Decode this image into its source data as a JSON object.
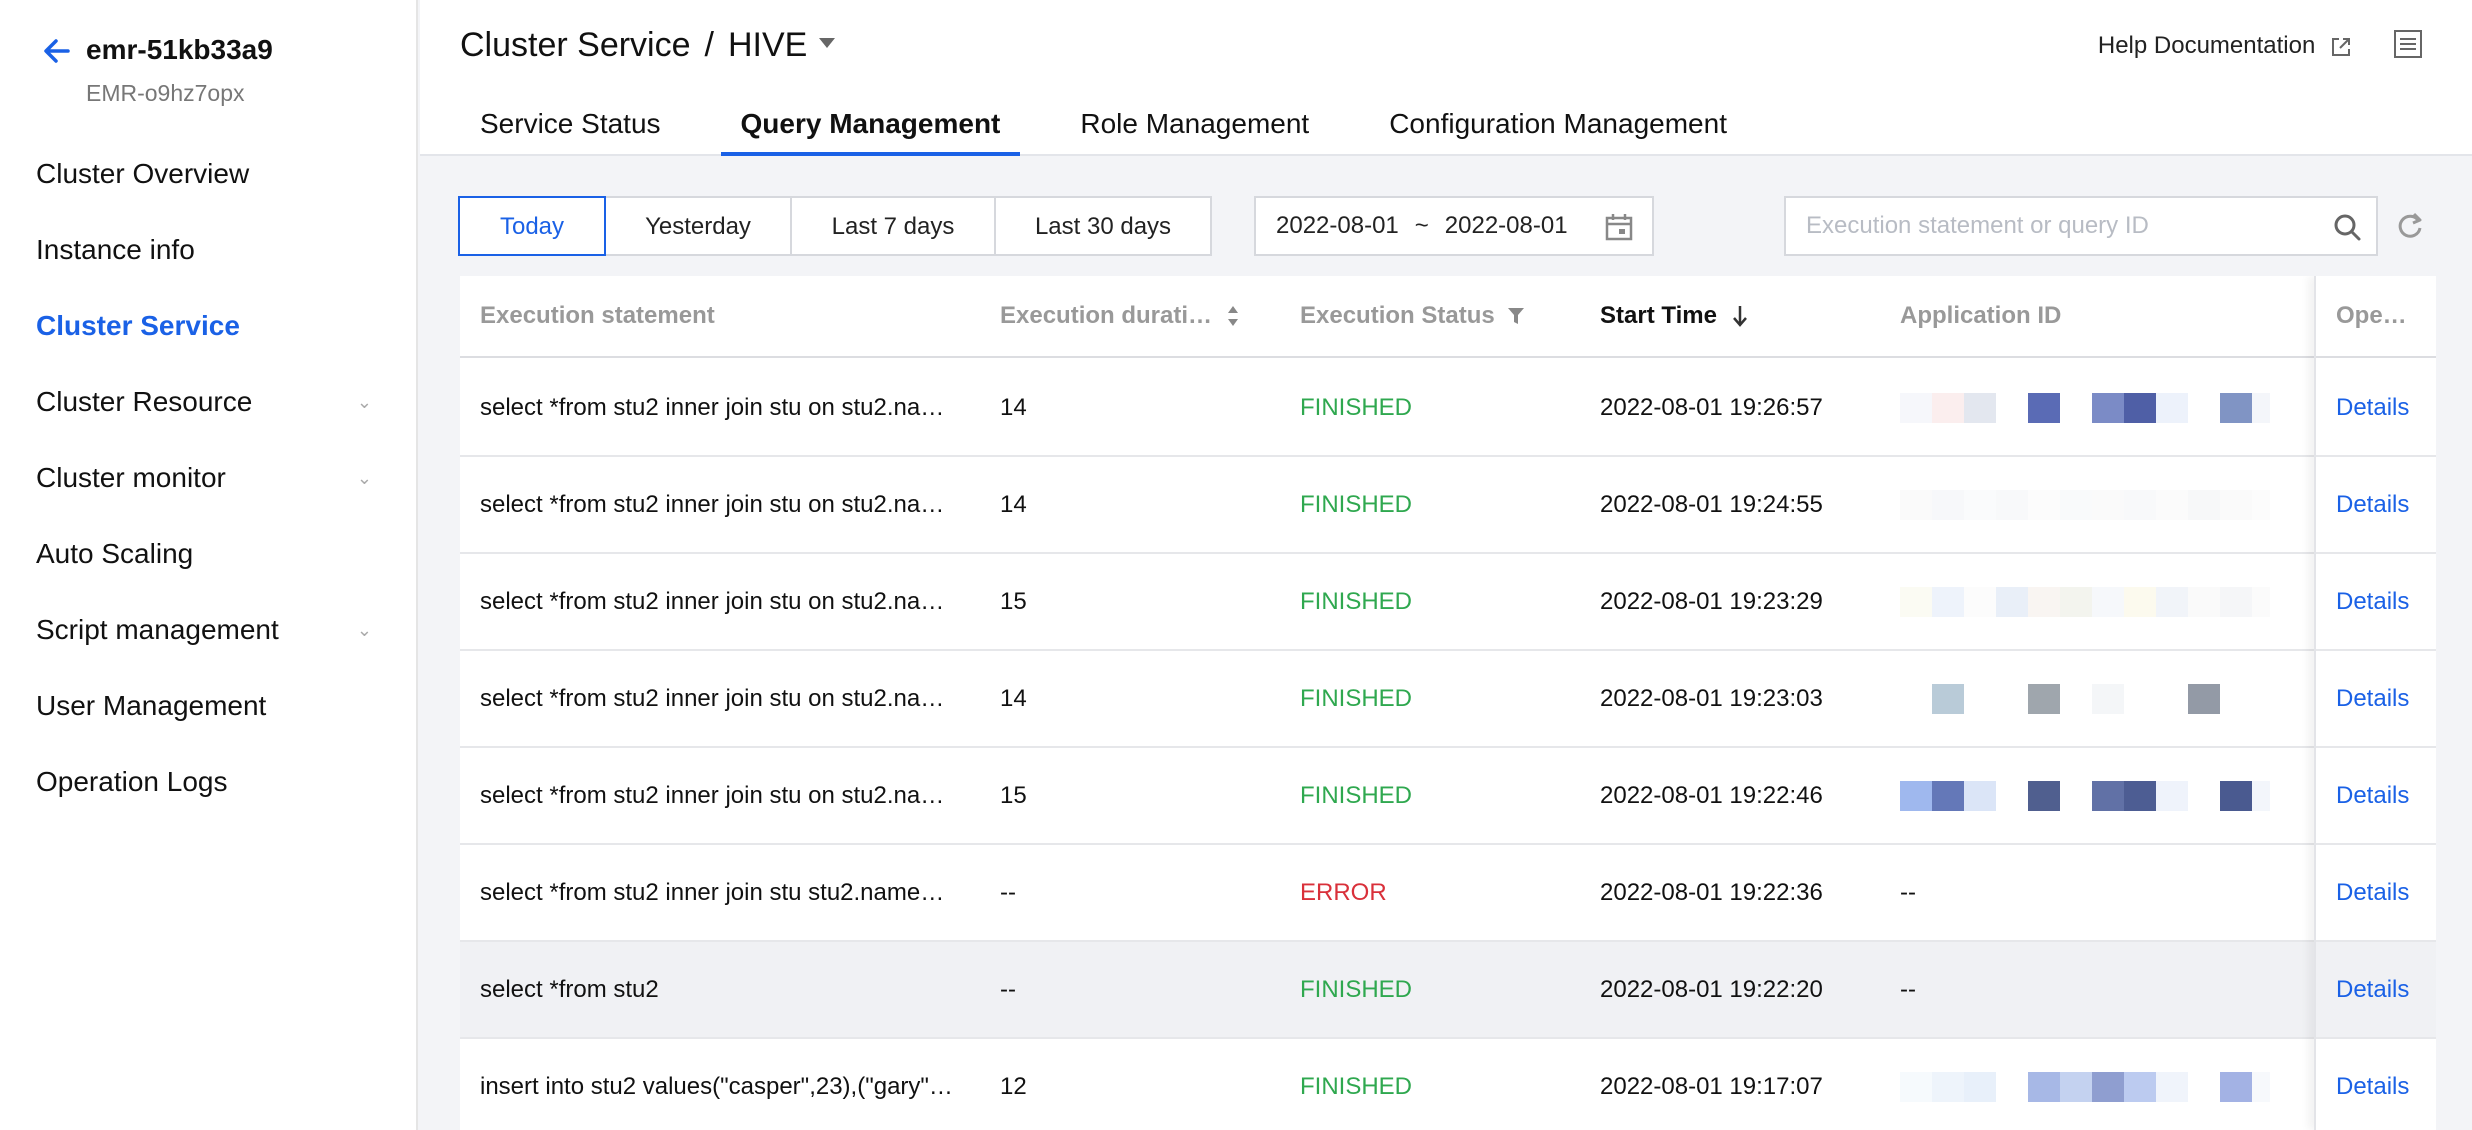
{
  "sidebar": {
    "cluster_name": "emr-51kb33a9",
    "cluster_id": "EMR-o9hz7opx",
    "items": [
      {
        "label": "Cluster Overview",
        "active": false,
        "expandable": false
      },
      {
        "label": "Instance info",
        "active": false,
        "expandable": false
      },
      {
        "label": "Cluster Service",
        "active": true,
        "expandable": false
      },
      {
        "label": "Cluster Resource",
        "active": false,
        "expandable": true
      },
      {
        "label": "Cluster monitor",
        "active": false,
        "expandable": true
      },
      {
        "label": "Auto Scaling",
        "active": false,
        "expandable": false
      },
      {
        "label": "Script management",
        "active": false,
        "expandable": true
      },
      {
        "label": "User Management",
        "active": false,
        "expandable": false
      },
      {
        "label": "Operation Logs",
        "active": false,
        "expandable": false
      }
    ]
  },
  "header": {
    "breadcrumb_parent": "Cluster Service",
    "breadcrumb_sep": "/",
    "breadcrumb_current": "HIVE",
    "help_label": "Help Documentation",
    "tabs": [
      {
        "label": "Service Status",
        "active": false
      },
      {
        "label": "Query Management",
        "active": true
      },
      {
        "label": "Role Management",
        "active": false
      },
      {
        "label": "Configuration Management",
        "active": false
      }
    ]
  },
  "filters": {
    "ranges": [
      {
        "label": "Today",
        "active": true
      },
      {
        "label": "Yesterday",
        "active": false
      },
      {
        "label": "Last 7 days",
        "active": false
      },
      {
        "label": "Last 30 days",
        "active": false
      }
    ],
    "date_from": "2022-08-01",
    "date_sep": "~",
    "date_to": "2022-08-01",
    "search_placeholder": "Execution statement or query ID",
    "search_value": ""
  },
  "table": {
    "columns": {
      "statement": "Execution statement",
      "duration": "Execution durati…",
      "status": "Execution Status",
      "start_time": "Start Time",
      "app_id": "Application ID",
      "ops": "Ope…"
    },
    "rows": [
      {
        "statement": "select *from stu2 inner join stu on  stu2.na…",
        "duration": "14",
        "status": "FINISHED",
        "start_time": "2022-08-01 19:26:57",
        "app_id": "",
        "app_id_redacted": true,
        "action": "Details"
      },
      {
        "statement": "select *from stu2 inner join stu on  stu2.na…",
        "duration": "14",
        "status": "FINISHED",
        "start_time": "2022-08-01 19:24:55",
        "app_id": "",
        "app_id_redacted": true,
        "action": "Details"
      },
      {
        "statement": "select *from stu2 inner join stu on  stu2.na…",
        "duration": "15",
        "status": "FINISHED",
        "start_time": "2022-08-01 19:23:29",
        "app_id": "",
        "app_id_redacted": true,
        "action": "Details"
      },
      {
        "statement": "select *from stu2 inner join stu on  stu2.na…",
        "duration": "14",
        "status": "FINISHED",
        "start_time": "2022-08-01 19:23:03",
        "app_id": "",
        "app_id_redacted": true,
        "action": "Details"
      },
      {
        "statement": "select *from stu2 inner join stu on  stu2.na…",
        "duration": "15",
        "status": "FINISHED",
        "start_time": "2022-08-01 19:22:46",
        "app_id": "",
        "app_id_redacted": true,
        "action": "Details"
      },
      {
        "statement": "select *from stu2 inner join stu stu2.name…",
        "duration": "--",
        "status": "ERROR",
        "start_time": "2022-08-01 19:22:36",
        "app_id": "--",
        "app_id_redacted": false,
        "action": "Details"
      },
      {
        "statement": "select *from stu2",
        "duration": "--",
        "status": "FINISHED",
        "start_time": "2022-08-01 19:22:20",
        "app_id": "--",
        "app_id_redacted": false,
        "action": "Details",
        "highlighted": true
      },
      {
        "statement": "insert into stu2 values(\"casper\",23),(\"gary\"…",
        "duration": "12",
        "status": "FINISHED",
        "start_time": "2022-08-01 19:17:07",
        "app_id": "",
        "app_id_redacted": true,
        "action": "Details"
      }
    ]
  },
  "colors": {
    "accent": "#1a61e6",
    "finished": "#2fa84f",
    "error": "#d9303a"
  }
}
